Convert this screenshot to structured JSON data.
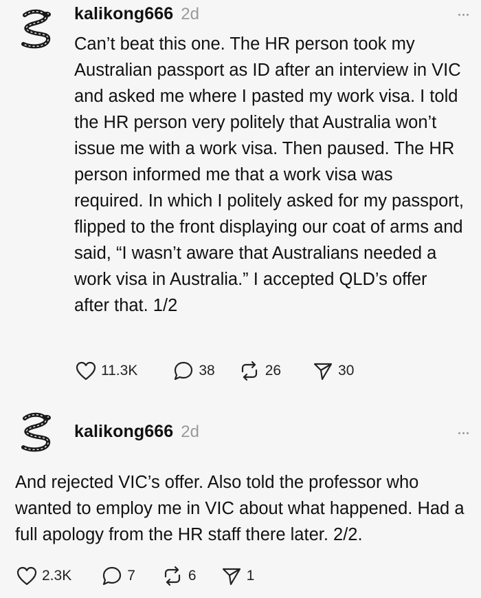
{
  "posts": [
    {
      "username": "kalikong666",
      "timestamp": "2d",
      "text": "Can’t beat this one. The HR person took my Australian passport as ID after an interview in VIC and asked me where I pasted my work visa. I told the HR person very politely that Australia won’t issue me with a work visa. Then paused. The HR person informed me that a work visa was required. In which I politely asked for my passport, flipped to the front displaying our coat of arms and said, “I wasn’t aware that Australians needed a work visa in Australia.” I accepted QLD’s offer after that. 1/2",
      "likes": "11.3K",
      "replies": "38",
      "reposts": "26",
      "shares": "30"
    },
    {
      "username": "kalikong666",
      "timestamp": "2d",
      "text": "And rejected VIC’s offer. Also told the professor who wanted to employ me in VIC about what happened. Had a full apology from the HR staff there later. 2/2.",
      "likes": "2.3K",
      "replies": "7",
      "reposts": "6",
      "shares": "1"
    }
  ],
  "icons": {
    "like": "heart-icon",
    "reply": "speech-bubble-icon",
    "repost": "repost-arrows-icon",
    "share": "send-icon",
    "more": "more-dots-icon",
    "avatar": "snake-avatar"
  },
  "colors": {
    "background": "#f6f6f6",
    "text": "#111111",
    "muted": "#9a9a9a"
  }
}
